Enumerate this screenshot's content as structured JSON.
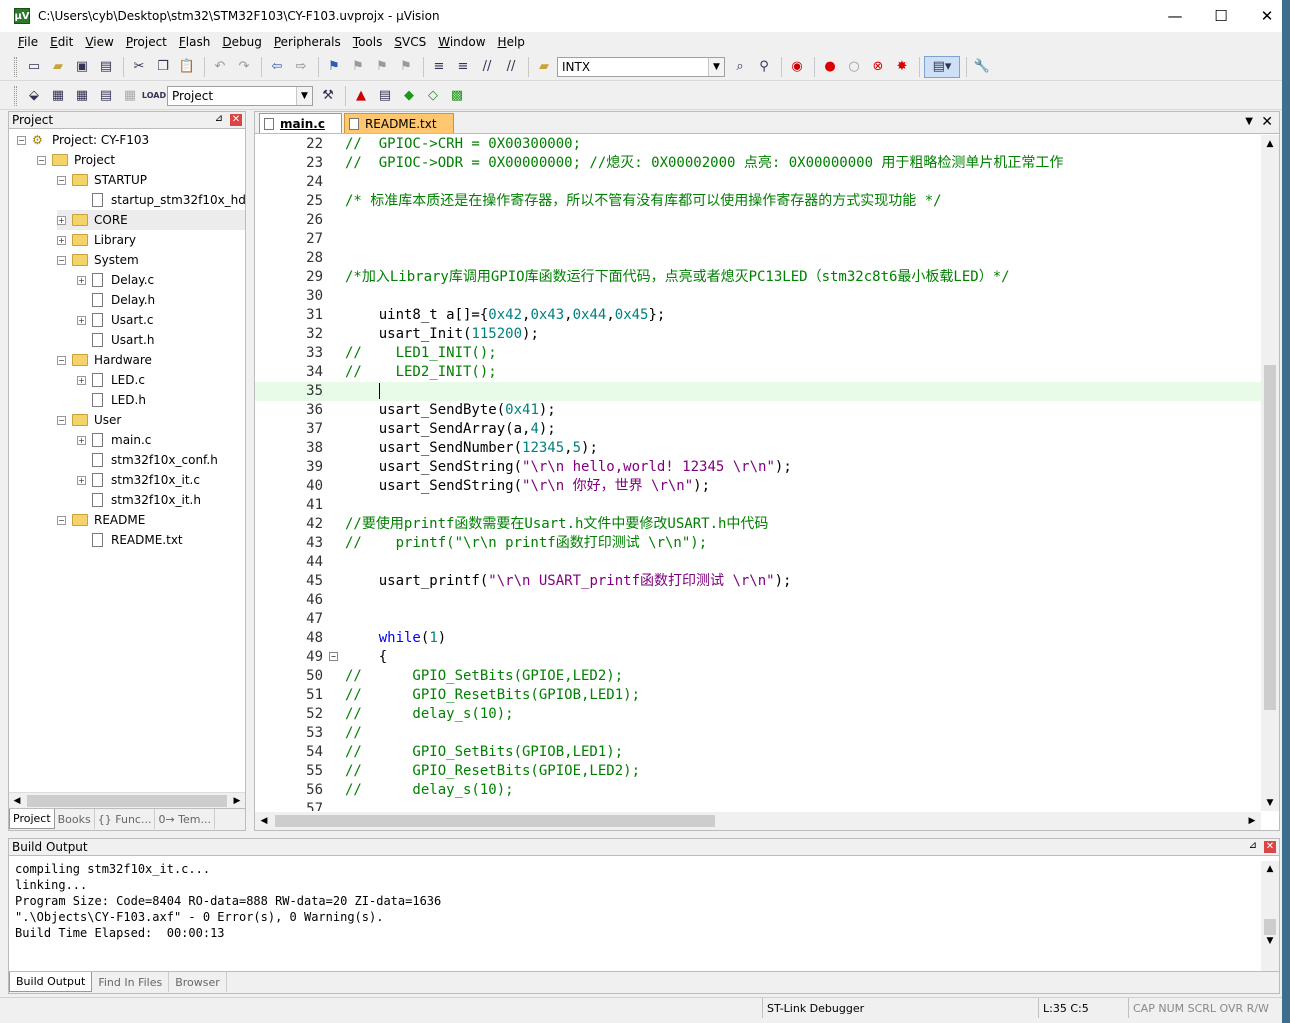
{
  "window": {
    "title": "C:\\Users\\cyb\\Desktop\\stm32\\STM32F103\\CY-F103.uvprojx - µVision",
    "app_icon": "µV",
    "minimize": "—",
    "maximize": "☐",
    "close": "✕"
  },
  "menu": [
    {
      "u": "F",
      "rest": "ile"
    },
    {
      "u": "E",
      "rest": "dit"
    },
    {
      "u": "V",
      "rest": "iew"
    },
    {
      "u": "P",
      "rest": "roject"
    },
    {
      "u": "F",
      "rest": "lash"
    },
    {
      "u": "D",
      "rest": "ebug"
    },
    {
      "u": "P",
      "rest": "eripherals"
    },
    {
      "u": "T",
      "rest": "ools"
    },
    {
      "u": "S",
      "rest": "VCS"
    },
    {
      "u": "W",
      "rest": "indow"
    },
    {
      "u": "H",
      "rest": "elp"
    }
  ],
  "toolbar1": {
    "find_combo": "INTX"
  },
  "toolbar2": {
    "target_combo": "Project"
  },
  "project_panel": {
    "title": "Project",
    "pin": "⊿",
    "close": "✕",
    "tree": [
      {
        "label": "Project: CY-F103",
        "kind": "proj",
        "depth": 0,
        "exp": "−"
      },
      {
        "label": "Project",
        "kind": "folder",
        "depth": 1,
        "exp": "−"
      },
      {
        "label": "STARTUP",
        "kind": "folder",
        "depth": 2,
        "exp": "−"
      },
      {
        "label": "startup_stm32f10x_hd.s",
        "kind": "file",
        "depth": 3,
        "exp": ""
      },
      {
        "label": "CORE",
        "kind": "folder",
        "depth": 2,
        "exp": "+"
      },
      {
        "label": "Library",
        "kind": "folder",
        "depth": 2,
        "exp": "+"
      },
      {
        "label": "System",
        "kind": "folder",
        "depth": 2,
        "exp": "−"
      },
      {
        "label": "Delay.c",
        "kind": "file",
        "depth": 3,
        "exp": "+"
      },
      {
        "label": "Delay.h",
        "kind": "file",
        "depth": 3,
        "exp": ""
      },
      {
        "label": "Usart.c",
        "kind": "file",
        "depth": 3,
        "exp": "+"
      },
      {
        "label": "Usart.h",
        "kind": "file",
        "depth": 3,
        "exp": ""
      },
      {
        "label": "Hardware",
        "kind": "folder",
        "depth": 2,
        "exp": "−"
      },
      {
        "label": "LED.c",
        "kind": "file",
        "depth": 3,
        "exp": "+"
      },
      {
        "label": "LED.h",
        "kind": "file",
        "depth": 3,
        "exp": ""
      },
      {
        "label": "User",
        "kind": "folder",
        "depth": 2,
        "exp": "−"
      },
      {
        "label": "main.c",
        "kind": "file",
        "depth": 3,
        "exp": "+"
      },
      {
        "label": "stm32f10x_conf.h",
        "kind": "file",
        "depth": 3,
        "exp": ""
      },
      {
        "label": "stm32f10x_it.c",
        "kind": "file",
        "depth": 3,
        "exp": "+"
      },
      {
        "label": "stm32f10x_it.h",
        "kind": "file",
        "depth": 3,
        "exp": ""
      },
      {
        "label": "README",
        "kind": "folder",
        "depth": 2,
        "exp": "−"
      },
      {
        "label": "README.txt",
        "kind": "file",
        "depth": 3,
        "exp": ""
      }
    ],
    "tabs": [
      "Project",
      "Books",
      "{} Func...",
      "0→ Tem..."
    ]
  },
  "editor": {
    "tabs": [
      {
        "label": "main.c",
        "active": true
      },
      {
        "label": "README.txt",
        "active": false
      }
    ],
    "lines": [
      {
        "n": "22",
        "t": [
          [
            "c",
            "//  GPIOC->CRH = 0X00300000;"
          ]
        ]
      },
      {
        "n": "23",
        "t": [
          [
            "c",
            "//  GPIOC->ODR = 0X00000000; //熄灭: 0X00002000 点亮: 0X00000000 用于粗略检测单片机正常工作"
          ]
        ]
      },
      {
        "n": "24",
        "t": []
      },
      {
        "n": "25",
        "t": [
          [
            "c",
            "/* 标准库本质还是在操作寄存器，所以不管有没有库都可以使用操作寄存器的方式实现功能 */"
          ]
        ]
      },
      {
        "n": "26",
        "t": []
      },
      {
        "n": "27",
        "t": []
      },
      {
        "n": "28",
        "t": []
      },
      {
        "n": "29",
        "t": [
          [
            "c",
            "/*加入Library库调用GPIO库函数运行下面代码，点亮或者熄灭PC13LED（stm32c8t6最小板载LED）*/"
          ]
        ]
      },
      {
        "n": "30",
        "t": []
      },
      {
        "n": "31",
        "t": [
          [
            "p",
            "    uint8_t a[]={"
          ],
          [
            "n",
            "0x42"
          ],
          [
            "p",
            ","
          ],
          [
            "n",
            "0x43"
          ],
          [
            "p",
            ","
          ],
          [
            "n",
            "0x44"
          ],
          [
            "p",
            ","
          ],
          [
            "n",
            "0x45"
          ],
          [
            "p",
            "};"
          ]
        ]
      },
      {
        "n": "32",
        "t": [
          [
            "p",
            "    usart_Init("
          ],
          [
            "n",
            "115200"
          ],
          [
            "p",
            ");"
          ]
        ]
      },
      {
        "n": "33",
        "t": [
          [
            "c",
            "//    LED1_INIT();"
          ]
        ]
      },
      {
        "n": "34",
        "t": [
          [
            "c",
            "//    LED2_INIT();"
          ]
        ]
      },
      {
        "n": "35",
        "t": [
          [
            "p",
            "    "
          ],
          [
            "caret",
            ""
          ]
        ],
        "current": true
      },
      {
        "n": "36",
        "t": [
          [
            "p",
            "    usart_SendByte("
          ],
          [
            "n",
            "0x41"
          ],
          [
            "p",
            ");"
          ]
        ]
      },
      {
        "n": "37",
        "t": [
          [
            "p",
            "    usart_SendArray(a,"
          ],
          [
            "n",
            "4"
          ],
          [
            "p",
            ");"
          ]
        ]
      },
      {
        "n": "38",
        "t": [
          [
            "p",
            "    usart_SendNumber("
          ],
          [
            "n",
            "12345"
          ],
          [
            "p",
            ","
          ],
          [
            "n",
            "5"
          ],
          [
            "p",
            ");"
          ]
        ]
      },
      {
        "n": "39",
        "t": [
          [
            "p",
            "    usart_SendString("
          ],
          [
            "s",
            "\"\\r\\n hello,world! 12345 \\r\\n\""
          ],
          [
            "p",
            ");"
          ]
        ]
      },
      {
        "n": "40",
        "t": [
          [
            "p",
            "    usart_SendString("
          ],
          [
            "s",
            "\"\\r\\n 你好，世界 \\r\\n\""
          ],
          [
            "p",
            ");"
          ]
        ]
      },
      {
        "n": "41",
        "t": []
      },
      {
        "n": "42",
        "t": [
          [
            "c",
            "//要使用printf函数需要在Usart.h文件中要修改USART.h中代码"
          ]
        ]
      },
      {
        "n": "43",
        "t": [
          [
            "c",
            "//    printf(\"\\r\\n printf函数打印测试 \\r\\n\");"
          ]
        ]
      },
      {
        "n": "44",
        "t": []
      },
      {
        "n": "45",
        "t": [
          [
            "p",
            "    usart_printf("
          ],
          [
            "s",
            "\"\\r\\n USART_printf函数打印测试 \\r\\n\""
          ],
          [
            "p",
            ");"
          ]
        ]
      },
      {
        "n": "46",
        "t": []
      },
      {
        "n": "47",
        "t": []
      },
      {
        "n": "48",
        "t": [
          [
            "p",
            "    "
          ],
          [
            "k",
            "while"
          ],
          [
            "p",
            "("
          ],
          [
            "n",
            "1"
          ],
          [
            "p",
            ")"
          ]
        ]
      },
      {
        "n": "49",
        "t": [
          [
            "p",
            "    {"
          ]
        ],
        "fold": true
      },
      {
        "n": "50",
        "t": [
          [
            "c",
            "//      GPIO_SetBits(GPIOE,LED2);"
          ]
        ]
      },
      {
        "n": "51",
        "t": [
          [
            "c",
            "//      GPIO_ResetBits(GPIOB,LED1);"
          ]
        ]
      },
      {
        "n": "52",
        "t": [
          [
            "c",
            "//      delay_s(10);"
          ]
        ]
      },
      {
        "n": "53",
        "t": [
          [
            "c",
            "//"
          ]
        ]
      },
      {
        "n": "54",
        "t": [
          [
            "c",
            "//      GPIO_SetBits(GPIOB,LED1);"
          ]
        ]
      },
      {
        "n": "55",
        "t": [
          [
            "c",
            "//      GPIO_ResetBits(GPIOE,LED2);"
          ]
        ]
      },
      {
        "n": "56",
        "t": [
          [
            "c",
            "//      delay_s(10);"
          ]
        ]
      },
      {
        "n": "57",
        "t": []
      }
    ]
  },
  "build_output": {
    "title": "Build Output",
    "lines": [
      "compiling stm32f10x_it.c...",
      "linking...",
      "Program Size: Code=8404 RO-data=888 RW-data=20 ZI-data=1636",
      "\".\\Objects\\CY-F103.axf\" - 0 Error(s), 0 Warning(s).",
      "Build Time Elapsed:  00:00:13"
    ],
    "tabs": [
      "Build Output",
      "Find In Files",
      "Browser"
    ]
  },
  "status": {
    "debugger": "ST-Link Debugger",
    "position": "L:35 C:5",
    "caps": "CAP NUM SCRL OVR R/W"
  }
}
